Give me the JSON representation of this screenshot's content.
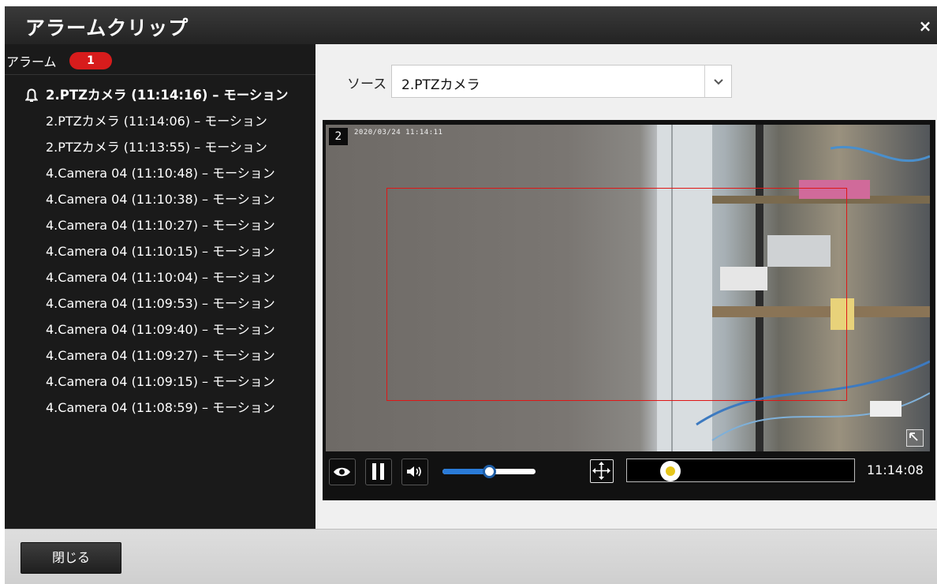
{
  "dialog": {
    "title": "アラームクリップ",
    "close_icon": "×"
  },
  "sidebar": {
    "alarm_label": "アラーム",
    "alarm_count": "1",
    "items": [
      {
        "label": "2.PTZカメラ (11:14:16) – モーション",
        "active": true
      },
      {
        "label": "2.PTZカメラ (11:14:06) – モーション"
      },
      {
        "label": "2.PTZカメラ (11:13:55) – モーション"
      },
      {
        "label": "4.Camera 04 (11:10:48) – モーション"
      },
      {
        "label": "4.Camera 04 (11:10:38) – モーション"
      },
      {
        "label": "4.Camera 04 (11:10:27) – モーション"
      },
      {
        "label": "4.Camera 04 (11:10:15) – モーション"
      },
      {
        "label": "4.Camera 04 (11:10:04) – モーション"
      },
      {
        "label": "4.Camera 04 (11:09:53) – モーション"
      },
      {
        "label": "4.Camera 04 (11:09:40) – モーション"
      },
      {
        "label": "4.Camera 04 (11:09:27) – モーション"
      },
      {
        "label": "4.Camera 04 (11:09:15) – モーション"
      },
      {
        "label": "4.Camera 04 (11:08:59) – モーション"
      }
    ]
  },
  "main": {
    "source_label": "ソース",
    "source_value": "2.PTZカメラ",
    "video": {
      "channel": "2",
      "osd_timestamp": "2020/03/24 11:14:11"
    },
    "controls": {
      "volume_level": 0.5,
      "timeline_position": 0.19,
      "time": "11:14:08"
    }
  },
  "footer": {
    "close_label": "閉じる"
  },
  "icons": [
    "bell-icon",
    "eye-icon",
    "pause-icon",
    "volume-icon",
    "pan-move-icon",
    "fullscreen-icon",
    "chevron-down-icon",
    "close-icon"
  ],
  "colors": {
    "badge": "#d71c1c",
    "motion_box": "#e01616",
    "volume_fill": "#2a7bd8",
    "timeline_knob": "#e6c61b"
  }
}
